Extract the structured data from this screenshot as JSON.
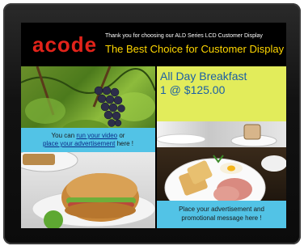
{
  "header": {
    "brand": "acode",
    "thank_you": "Thank you for choosing our ALD Series LCD Customer Display",
    "tagline": "The Best Choice for Customer Display"
  },
  "promo": {
    "line1": "All Day Breakfast",
    "line2": "1 @ $125.00"
  },
  "video_box": {
    "pre": "You can ",
    "link1": "run your video",
    "mid": " or",
    "link2": "place your advertisement",
    "post": " here !"
  },
  "message_box": {
    "line1": "Place your advertisement and",
    "line2": "promotional message here !"
  },
  "colors": {
    "brand_red": "#e2231a",
    "tagline_yellow": "#ffd700",
    "promo_bg": "#e2ec5b",
    "promo_text": "#1b5fa6",
    "info_blue": "#52c3e6"
  },
  "images": {
    "top_left": "grapes-photo",
    "bottom_left": "sandwich-photo",
    "bottom_right": "breakfast-plate-photo"
  }
}
